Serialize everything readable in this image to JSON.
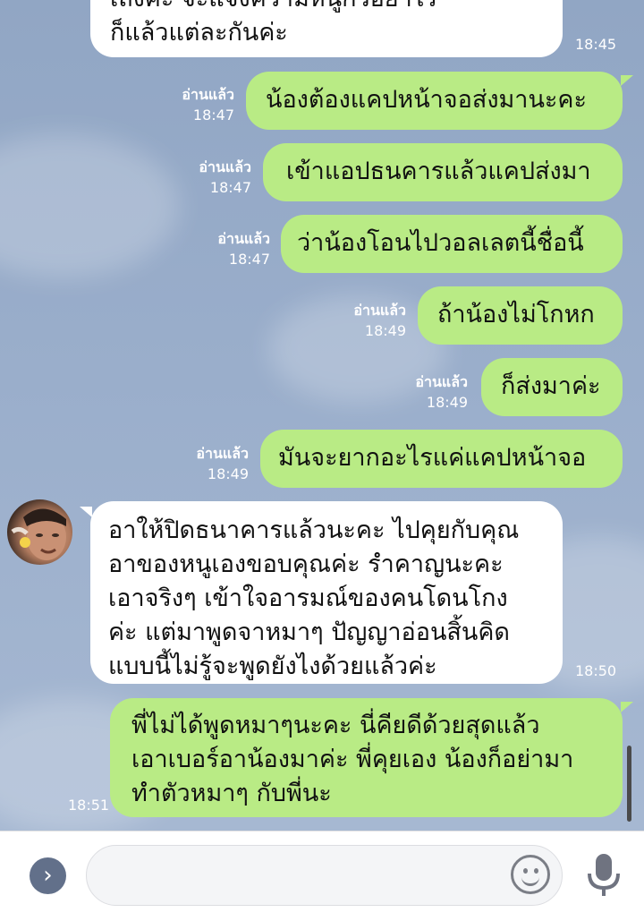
{
  "messages": [
    {
      "side": "left",
      "lines": [
        "เถิงค่ะ จะแจ้งความหนูก็วอย่าไร",
        "ก็แล้วแต่ละกันค่ะ"
      ],
      "time": "18:45"
    },
    {
      "side": "right",
      "lines": [
        "น้องต้องแคปหน้าจอส่งมานะคะ"
      ],
      "read": "อ่านแล้ว",
      "time": "18:47"
    },
    {
      "side": "right",
      "lines": [
        "เข้าแอปธนคารแล้วแคปส่งมา"
      ],
      "read": "อ่านแล้ว",
      "time": "18:47"
    },
    {
      "side": "right",
      "lines": [
        "ว่าน้องโอนไปวอลเลตนี้ชื่อนี้"
      ],
      "read": "อ่านแล้ว",
      "time": "18:47"
    },
    {
      "side": "right",
      "lines": [
        "ถ้าน้องไม่โกหก"
      ],
      "read": "อ่านแล้ว",
      "time": "18:49"
    },
    {
      "side": "right",
      "lines": [
        "ก็ส่งมาค่ะ"
      ],
      "read": "อ่านแล้ว",
      "time": "18:49"
    },
    {
      "side": "right",
      "lines": [
        "มันจะยากอะไรแค่แคปหน้าจอ"
      ],
      "read": "อ่านแล้ว",
      "time": "18:49"
    },
    {
      "side": "left",
      "lines": [
        "อาให้ปิดธนาคารแล้วนะคะ ไปคุยกับคุณ",
        "อาของหนูเองขอบคุณค่ะ รำคาญนะคะ",
        "เอาจริงๆ เข้าใจอารมณ์ของคนโดนโกง",
        "ค่ะ แต่มาพูดจาหมาๆ ปัญญาอ่อนสิ้นคิด",
        "แบบนี้ไม่รู้จะพูดยังไงด้วยแล้วค่ะ"
      ],
      "time": "18:50"
    },
    {
      "side": "right",
      "lines": [
        "พี่ไม่ได้พูดหมาๆนะคะ นี่คียดีด้วยสุดแล้ว",
        "เอาเบอร์อาน้องมาค่ะ พี่คุยเอง น้องก็อย่ามา",
        "ทำตัวหมาๆ กับพี่นะ"
      ],
      "time": "18:51"
    }
  ],
  "input": {
    "placeholder": "",
    "expand_icon": "chevron-right-icon",
    "emoji_icon": "smiley-icon",
    "mic_icon": "microphone-icon"
  },
  "colors": {
    "background": "#97abc9",
    "outgoing_bubble": "#b9eb85",
    "incoming_bubble": "#ffffff",
    "meta_text": "#ffffff"
  }
}
